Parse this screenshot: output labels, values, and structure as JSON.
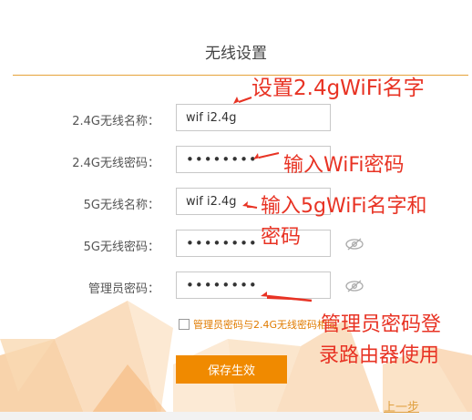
{
  "page": {
    "title": "无线设置"
  },
  "form": {
    "ssid_24": {
      "label": "2.4G无线名称：",
      "value": "wif i2.4g"
    },
    "pwd_24": {
      "label": "2.4G无线密码：",
      "value": "••••••••"
    },
    "ssid_5": {
      "label": "5G无线名称：",
      "value": "wif i2.4g"
    },
    "pwd_5": {
      "label": "5G无线密码：",
      "value": "••••••••"
    },
    "admin_pwd": {
      "label": "管理员密码：",
      "value": "••••••••"
    },
    "sync_label": "管理员密码与2.4G无线密码相同",
    "sync_checked": false
  },
  "actions": {
    "save_label": "保存生效",
    "prev_label": "上一步"
  },
  "annotations": {
    "a1": "设置2.4gWiFi名字",
    "a2": "输入WiFi密码",
    "a3_line1": "输入5gWiFi名字和",
    "a3_line2": "密码",
    "a4_line1": "管理员密码登",
    "a4_line2": "录路由器使用"
  },
  "colors": {
    "accent": "#f08a00",
    "annotation": "#e83324",
    "rule": "#e6a23a"
  },
  "icons": {
    "eye": "eye-off-icon"
  }
}
